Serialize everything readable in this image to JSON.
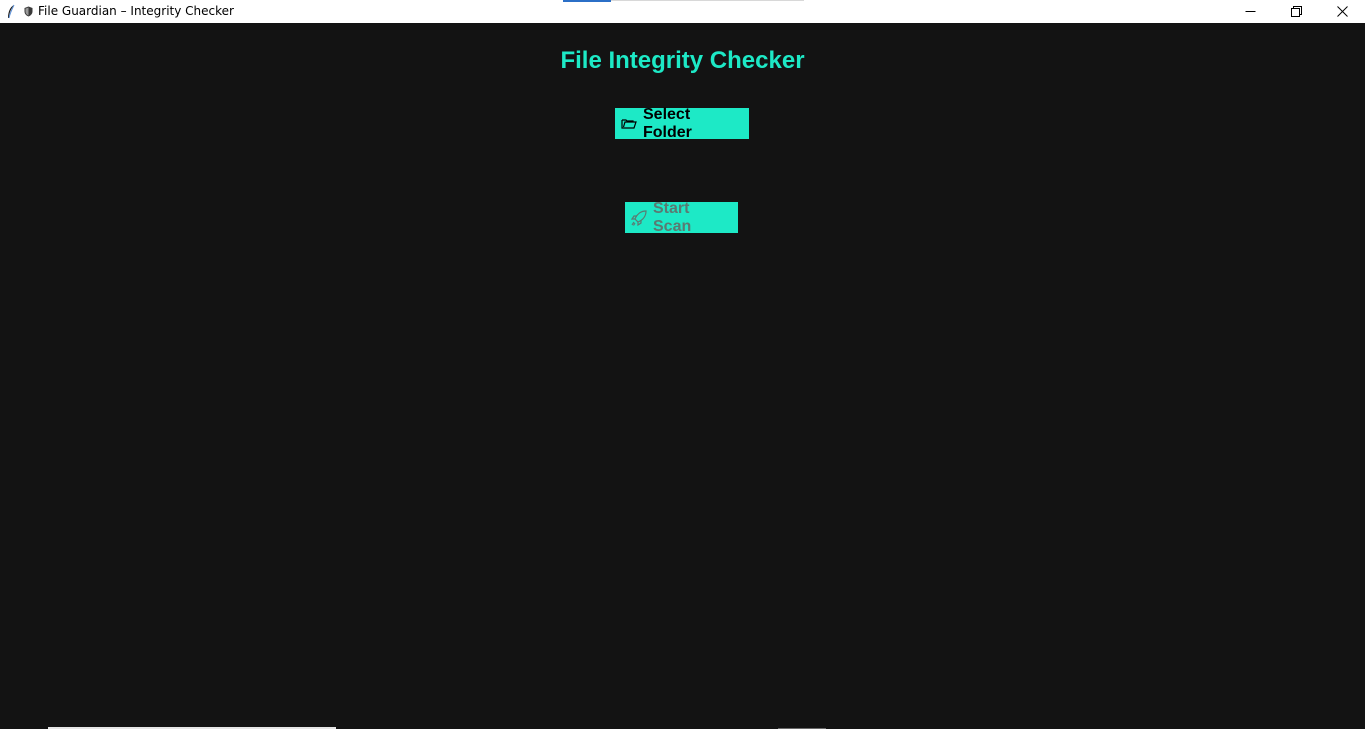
{
  "window": {
    "title": "File Guardian – Integrity Checker",
    "app_icon": "feather-icon",
    "title_icon": "shield-icon",
    "controls": {
      "minimize": "minimize-icon",
      "restore": "restore-icon",
      "close": "close-icon"
    }
  },
  "main": {
    "heading": "File Integrity Checker",
    "select_folder": {
      "label": "Select Folder",
      "icon": "open-folder-icon"
    },
    "start_scan": {
      "label": "Start Scan",
      "icon": "rocket-icon",
      "state": "disabled"
    }
  },
  "colors": {
    "background": "#131313",
    "accent": "#1de9c6",
    "titlebar": "#ffffff",
    "disabled_text": "#5a7a72"
  }
}
